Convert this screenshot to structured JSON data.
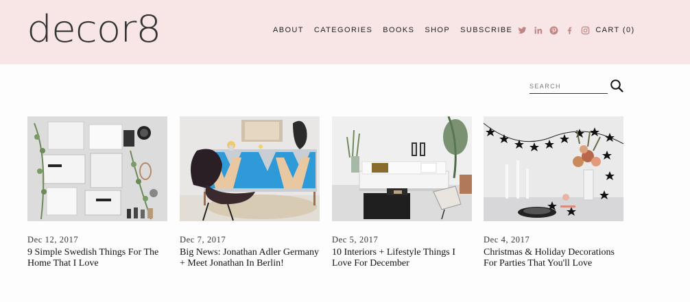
{
  "header": {
    "logo": "decor8",
    "nav": [
      {
        "label": "ABOUT"
      },
      {
        "label": "CATEGORIES"
      },
      {
        "label": "BOOKS"
      },
      {
        "label": "SHOP"
      },
      {
        "label": "SUBSCRIBE"
      }
    ],
    "socials": [
      "twitter-icon",
      "linkedin-icon",
      "pinterest-icon",
      "facebook-icon",
      "instagram-icon"
    ],
    "cart": "CART (0)",
    "background_color": "#f8e6e6",
    "icon_color": "#c08585"
  },
  "search": {
    "placeholder": "SEARCH"
  },
  "posts": [
    {
      "date": "Dec 12, 2017",
      "title": "9 Simple Swedish Things For The Home That I Love"
    },
    {
      "date": "Dec 7, 2017",
      "title": "Big News: Jonathan Adler Germany + Meet Jonathan In Berlin!"
    },
    {
      "date": "Dec 5, 2017",
      "title": "10 Interiors + Lifestyle Things I Love For December"
    },
    {
      "date": "Dec 4, 2017",
      "title": "Christmas & Holiday Decorations For Parties That You'll Love"
    }
  ]
}
